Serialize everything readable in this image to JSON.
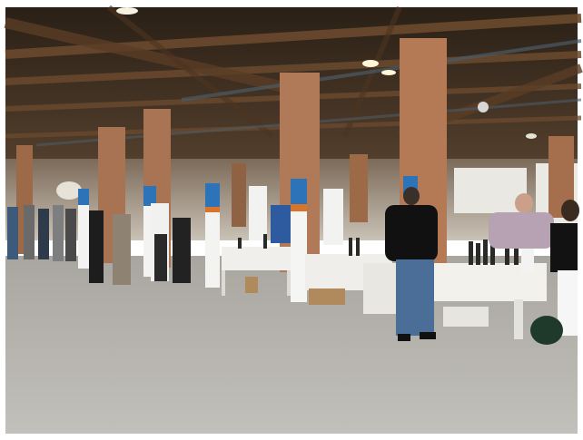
{
  "scene": {
    "kind": "photograph",
    "colors": {
      "frame": "#ffffff",
      "ceiling_dark": "#2f2418",
      "beam": "#6b4a2e",
      "brick_pillar": "#b47a55",
      "white_panel": "#f2f2f0",
      "table_top": "#efefeb",
      "floor": "#b9b7b1",
      "banner_blue": "#2d73b7",
      "banner_orange": "#d9752a"
    }
  }
}
